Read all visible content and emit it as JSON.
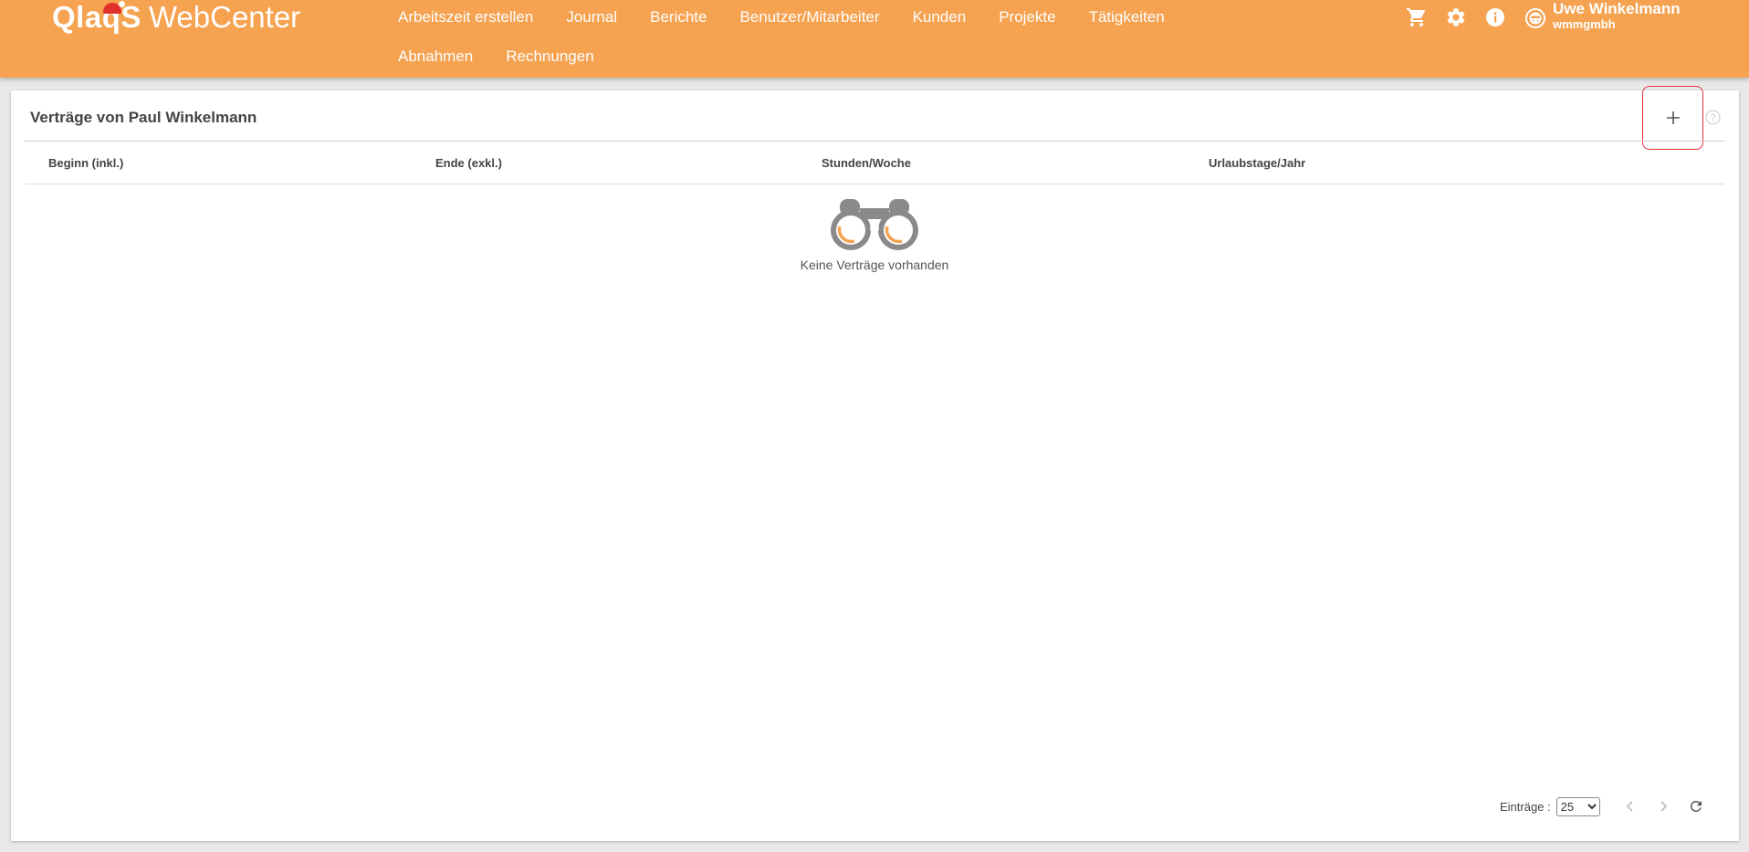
{
  "header": {
    "logo_text": "QlaqS",
    "app_name": "WebCenter",
    "nav_row1": [
      "Arbeitszeit erstellen",
      "Journal",
      "Berichte",
      "Benutzer/Mitarbeiter",
      "Kunden",
      "Projekte",
      "Tätigkeiten"
    ],
    "nav_row2": [
      "Abnahmen",
      "Rechnungen"
    ],
    "icons": [
      "cart-icon",
      "gear-icon",
      "info-icon"
    ],
    "user": {
      "name": "Uwe Winkelmann",
      "company": "wmmgmbh"
    }
  },
  "card": {
    "title": "Verträge von Paul Winkelmann",
    "columns": [
      "Beginn (inkl.)",
      "Ende (exkl.)",
      "Stunden/Woche",
      "Urlaubstage/Jahr"
    ],
    "empty_text": "Keine Verträge vorhanden"
  },
  "pager": {
    "label": "Einträge :",
    "page_size": "25",
    "page_size_options": [
      "25"
    ]
  },
  "colors": {
    "header_bg": "#f5a251",
    "highlight_border": "#e52f3a"
  }
}
